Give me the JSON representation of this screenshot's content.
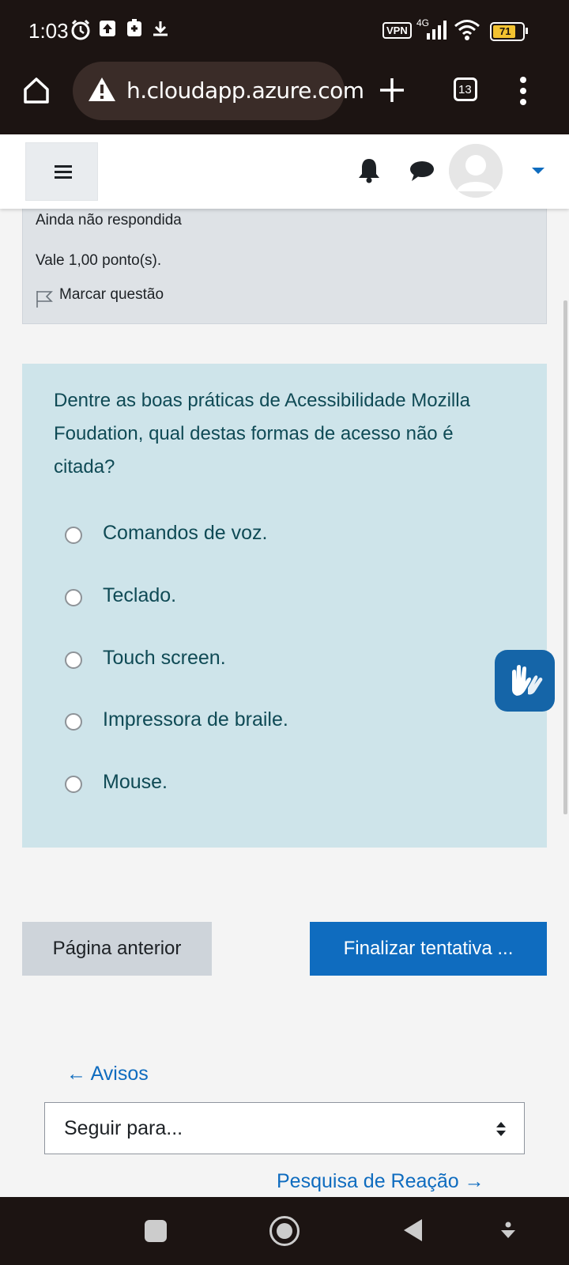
{
  "status_bar": {
    "time": "1:03",
    "vpn": "VPN",
    "network": "4G",
    "battery": "71",
    "icons": [
      "alarm-icon",
      "upload-icon",
      "notification-icon",
      "download-icon",
      "signal-icon",
      "wifi-icon",
      "battery-icon"
    ]
  },
  "browser": {
    "url": "h.cloudapp.azure.com",
    "tab_count": "13",
    "icons": [
      "home-icon",
      "warning-icon",
      "new-tab-icon",
      "tabs-icon",
      "menu-icon"
    ]
  },
  "navbar": {
    "icons": [
      "hamburger-icon",
      "bell-icon",
      "chat-icon",
      "avatar-icon",
      "caret-down-icon"
    ]
  },
  "question_info": {
    "status": "Ainda não respondida",
    "points": "Vale 1,00 ponto(s).",
    "flag_label": "Marcar questão"
  },
  "question": {
    "text": "Dentre as boas práticas de Acessibilidade Mozilla Foudation, qual destas formas de acesso não é citada?",
    "options": [
      "Comandos de voz.",
      "Teclado.",
      "Touch screen.",
      "Impressora de braile.",
      "Mouse."
    ]
  },
  "actions": {
    "prev_label": "Página anterior",
    "finish_label": "Finalizar tentativa ..."
  },
  "navigation": {
    "prev_link": "← Avisos",
    "jump_placeholder": "Seguir para...",
    "next_link": "Pesquisa de Reação →"
  },
  "colors": {
    "question_bg": "#cee4ea",
    "primary": "#0f6cbf",
    "info_bg": "#dee2e6"
  }
}
